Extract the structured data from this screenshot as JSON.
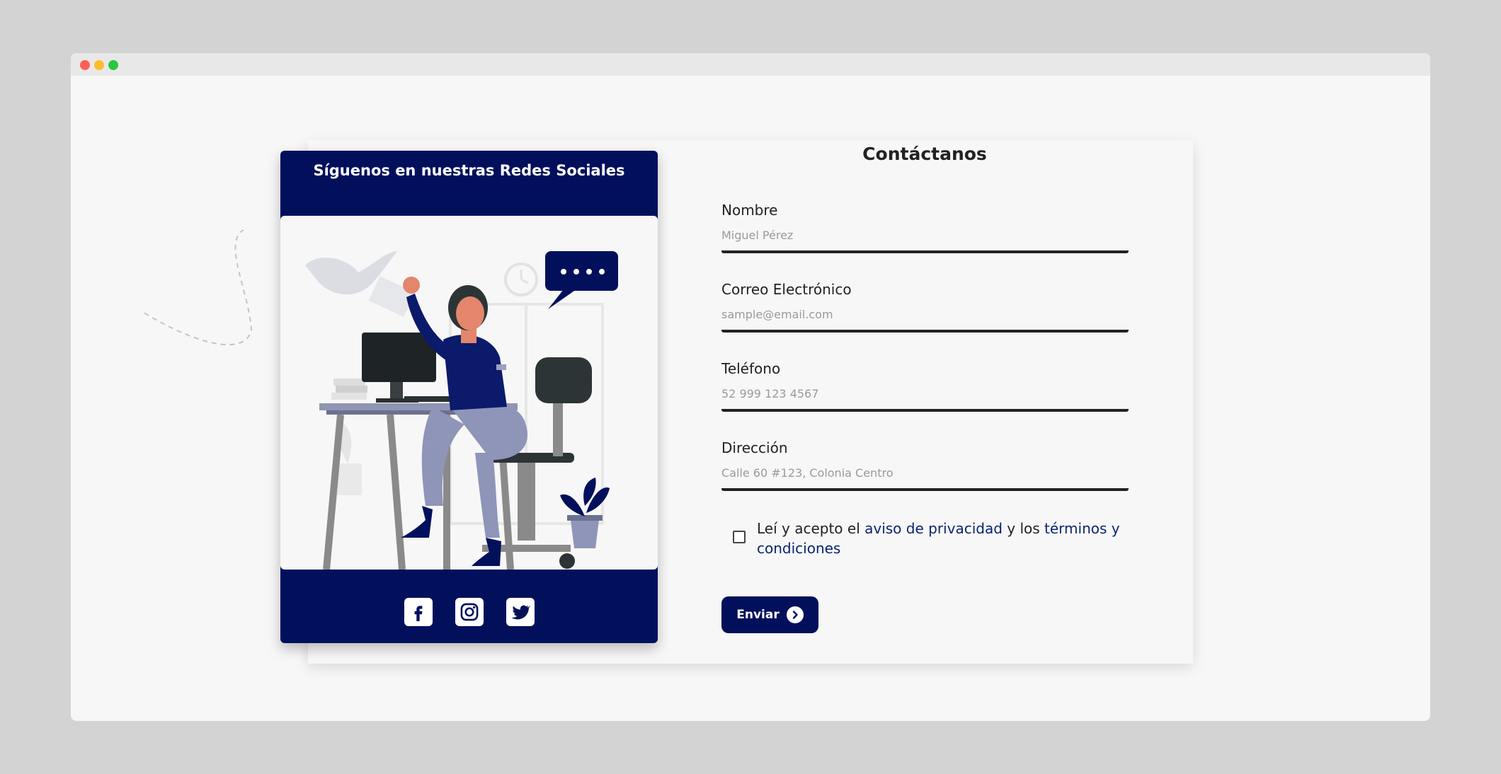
{
  "social": {
    "title": "Síguenos en nuestras Redes Sociales",
    "icons": [
      "facebook-icon",
      "instagram-icon",
      "twitter-icon"
    ]
  },
  "form": {
    "title": "Contáctanos",
    "fields": [
      {
        "label": "Nombre",
        "placeholder": "Miguel Pérez",
        "value": ""
      },
      {
        "label": "Correo Electrónico",
        "placeholder": "sample@email.com",
        "value": ""
      },
      {
        "label": "Teléfono",
        "placeholder": "52 999 123 4567",
        "value": ""
      },
      {
        "label": "Dirección",
        "placeholder": "Calle 60 #123, Colonia Centro",
        "value": ""
      }
    ],
    "terms": {
      "text_before": "Leí y acepto el ",
      "privacy_link": "aviso de privacidad",
      "text_middle": " y los ",
      "terms_link": "términos y condiciones",
      "checked": false
    },
    "submit_label": "Enviar"
  },
  "colors": {
    "accent": "#02105c",
    "background": "#f7f7f7",
    "page": "#d3d3d3"
  }
}
